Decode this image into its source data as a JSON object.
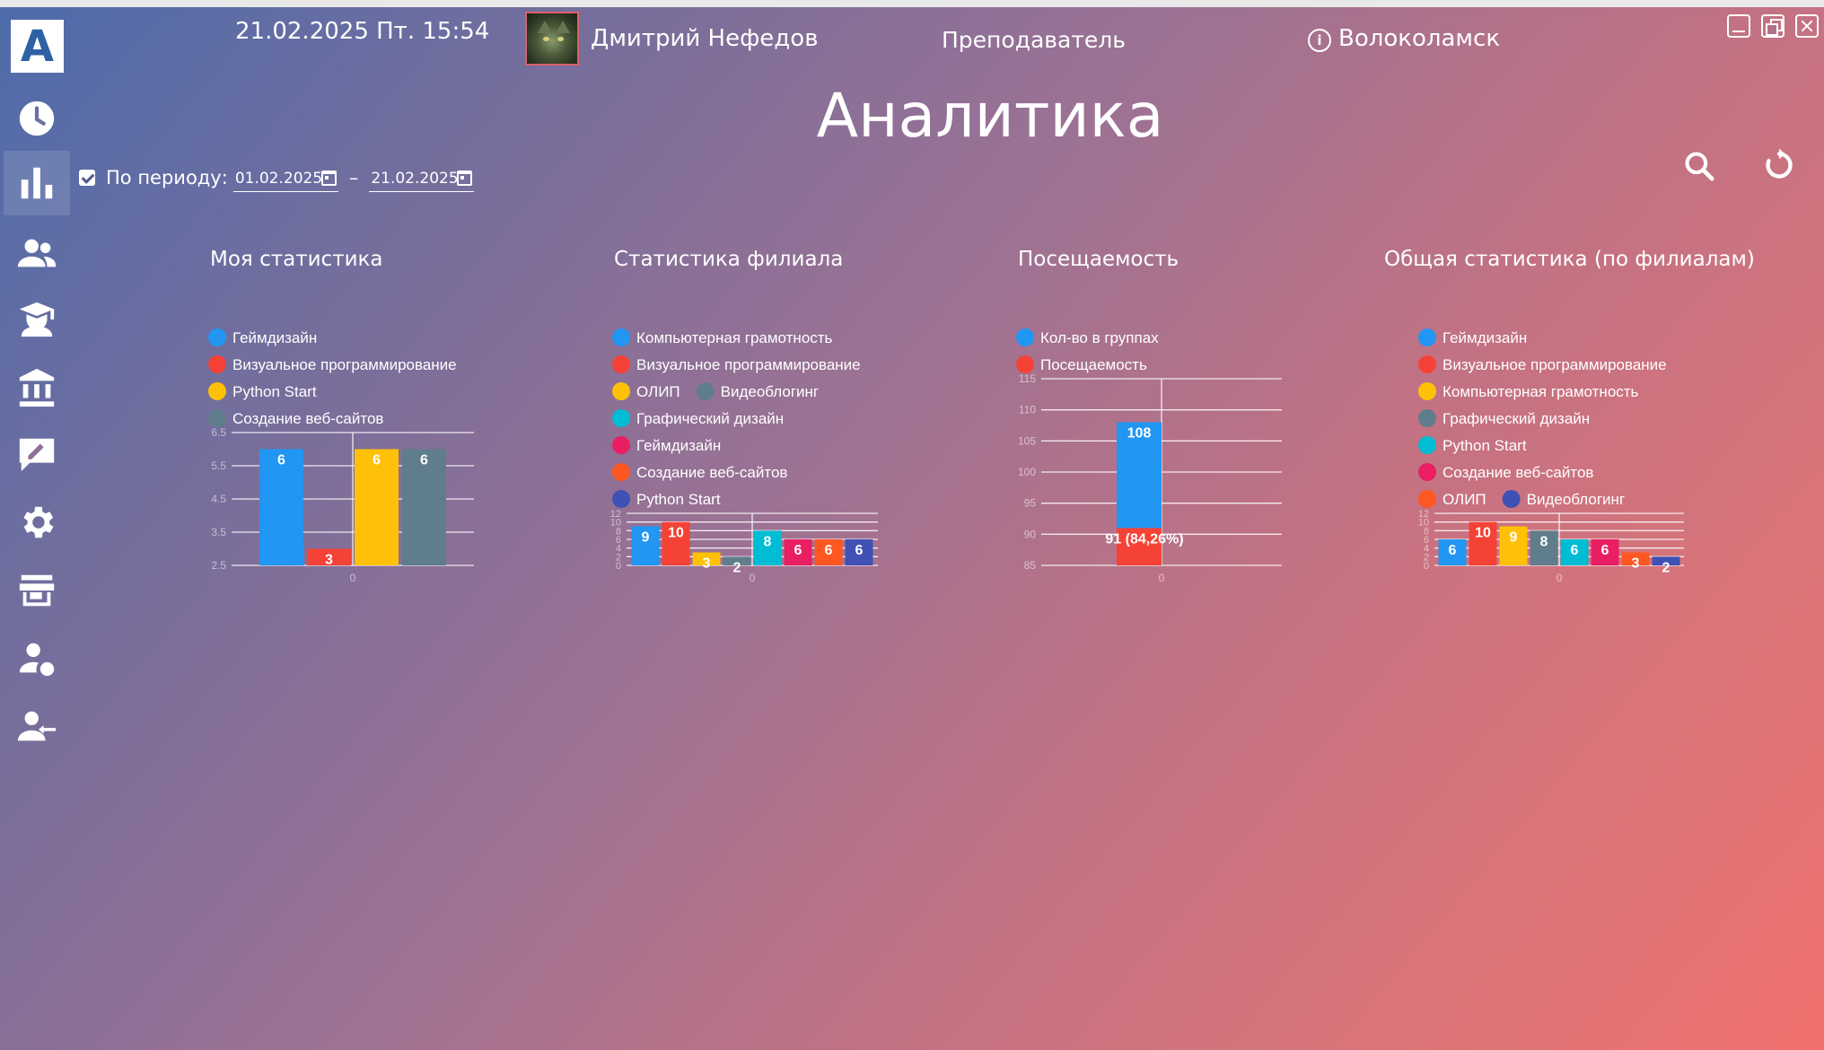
{
  "header": {
    "datetime": "21.02.2025 Пт. 15:54",
    "username": "Дмитрий Нефедов",
    "role": "Преподаватель",
    "city": "Волоколамск"
  },
  "page": {
    "title": "Аналитика"
  },
  "filter": {
    "checkbox_checked": true,
    "label": "По периоду:",
    "date_from": "01.02.2025",
    "date_to": "21.02.2025",
    "separator": "–"
  },
  "sidebar": {
    "logo": "A",
    "items": [
      {
        "icon": "clock-icon"
      },
      {
        "icon": "bar-chart-icon",
        "active": true
      },
      {
        "icon": "people-icon"
      },
      {
        "icon": "graduate-icon"
      },
      {
        "icon": "bank-icon"
      },
      {
        "icon": "edit-icon"
      },
      {
        "icon": "gear-icon"
      },
      {
        "icon": "store-icon"
      },
      {
        "icon": "person-settings-icon"
      },
      {
        "icon": "person-remove-icon"
      }
    ]
  },
  "panels": [
    {
      "title": "Моя статистика"
    },
    {
      "title": "Статистика филиала"
    },
    {
      "title": "Посещаемость"
    },
    {
      "title": "Общая статистика (по филиалам)"
    }
  ],
  "chart_data": [
    {
      "type": "bar",
      "title": "Моя статистика",
      "categories": [
        "0"
      ],
      "ylim": [
        2.5,
        6.5
      ],
      "yticks": [
        "6.5",
        "5.5",
        "4.5",
        "3.5",
        "2.5"
      ],
      "series": [
        {
          "name": "Геймдизайн",
          "color": "#2196f3",
          "values": [
            6
          ]
        },
        {
          "name": "Визуальное программирование",
          "color": "#f44336",
          "values": [
            3
          ]
        },
        {
          "name": "Python Start",
          "color": "#ffc107",
          "values": [
            6
          ]
        },
        {
          "name": "Создание веб-сайтов",
          "color": "#607d8b",
          "values": [
            6
          ]
        }
      ]
    },
    {
      "type": "bar",
      "title": "Статистика филиала",
      "categories": [
        "0"
      ],
      "ylim": [
        0,
        12
      ],
      "yticks": [
        "12",
        "10",
        "8",
        "6",
        "4",
        "2",
        "0"
      ],
      "series": [
        {
          "name": "Компьютерная грамотность",
          "color": "#2196f3",
          "values": [
            9
          ]
        },
        {
          "name": "Визуальное программирование",
          "color": "#f44336",
          "values": [
            10
          ]
        },
        {
          "name": "ОЛИП",
          "color": "#ffc107",
          "values": [
            3
          ]
        },
        {
          "name": "Видеоблогинг",
          "color": "#607d8b",
          "values": [
            2
          ]
        },
        {
          "name": "Графический дизайн",
          "color": "#00bcd4",
          "values": [
            8
          ]
        },
        {
          "name": "Геймдизайн",
          "color": "#e91e63",
          "values": [
            6
          ]
        },
        {
          "name": "Создание веб-сайтов",
          "color": "#ff5722",
          "values": [
            6
          ]
        },
        {
          "name": "Python Start",
          "color": "#3f51b5",
          "values": [
            6
          ]
        }
      ]
    },
    {
      "type": "bar",
      "title": "Посещаемость",
      "categories": [
        "0"
      ],
      "ylim": [
        85,
        115
      ],
      "yticks": [
        "115",
        "110",
        "105",
        "100",
        "95",
        "90",
        "85"
      ],
      "series": [
        {
          "name": "Кол-во в группах",
          "color": "#2196f3",
          "values": [
            108
          ],
          "label": "108"
        },
        {
          "name": "Посещаемость",
          "color": "#f44336",
          "values": [
            91
          ],
          "label": "91 (84,26%)"
        }
      ]
    },
    {
      "type": "bar",
      "title": "Общая статистика (по филиалам)",
      "categories": [
        "0"
      ],
      "ylim": [
        0,
        12
      ],
      "yticks": [
        "12",
        "10",
        "8",
        "6",
        "4",
        "2",
        "0"
      ],
      "series": [
        {
          "name": "Геймдизайн",
          "color": "#2196f3",
          "values": [
            6
          ]
        },
        {
          "name": "Визуальное программирование",
          "color": "#f44336",
          "values": [
            10
          ]
        },
        {
          "name": "Компьютерная грамотность",
          "color": "#ffc107",
          "values": [
            9
          ]
        },
        {
          "name": "Графический дизайн",
          "color": "#607d8b",
          "values": [
            8
          ]
        },
        {
          "name": "Python Start",
          "color": "#00bcd4",
          "values": [
            6
          ]
        },
        {
          "name": "Создание веб-сайтов",
          "color": "#e91e63",
          "values": [
            6
          ]
        },
        {
          "name": "ОЛИП",
          "color": "#ff5722",
          "values": [
            3
          ]
        },
        {
          "name": "Видеоблогинг",
          "color": "#3f51b5",
          "values": [
            2
          ]
        }
      ]
    }
  ]
}
